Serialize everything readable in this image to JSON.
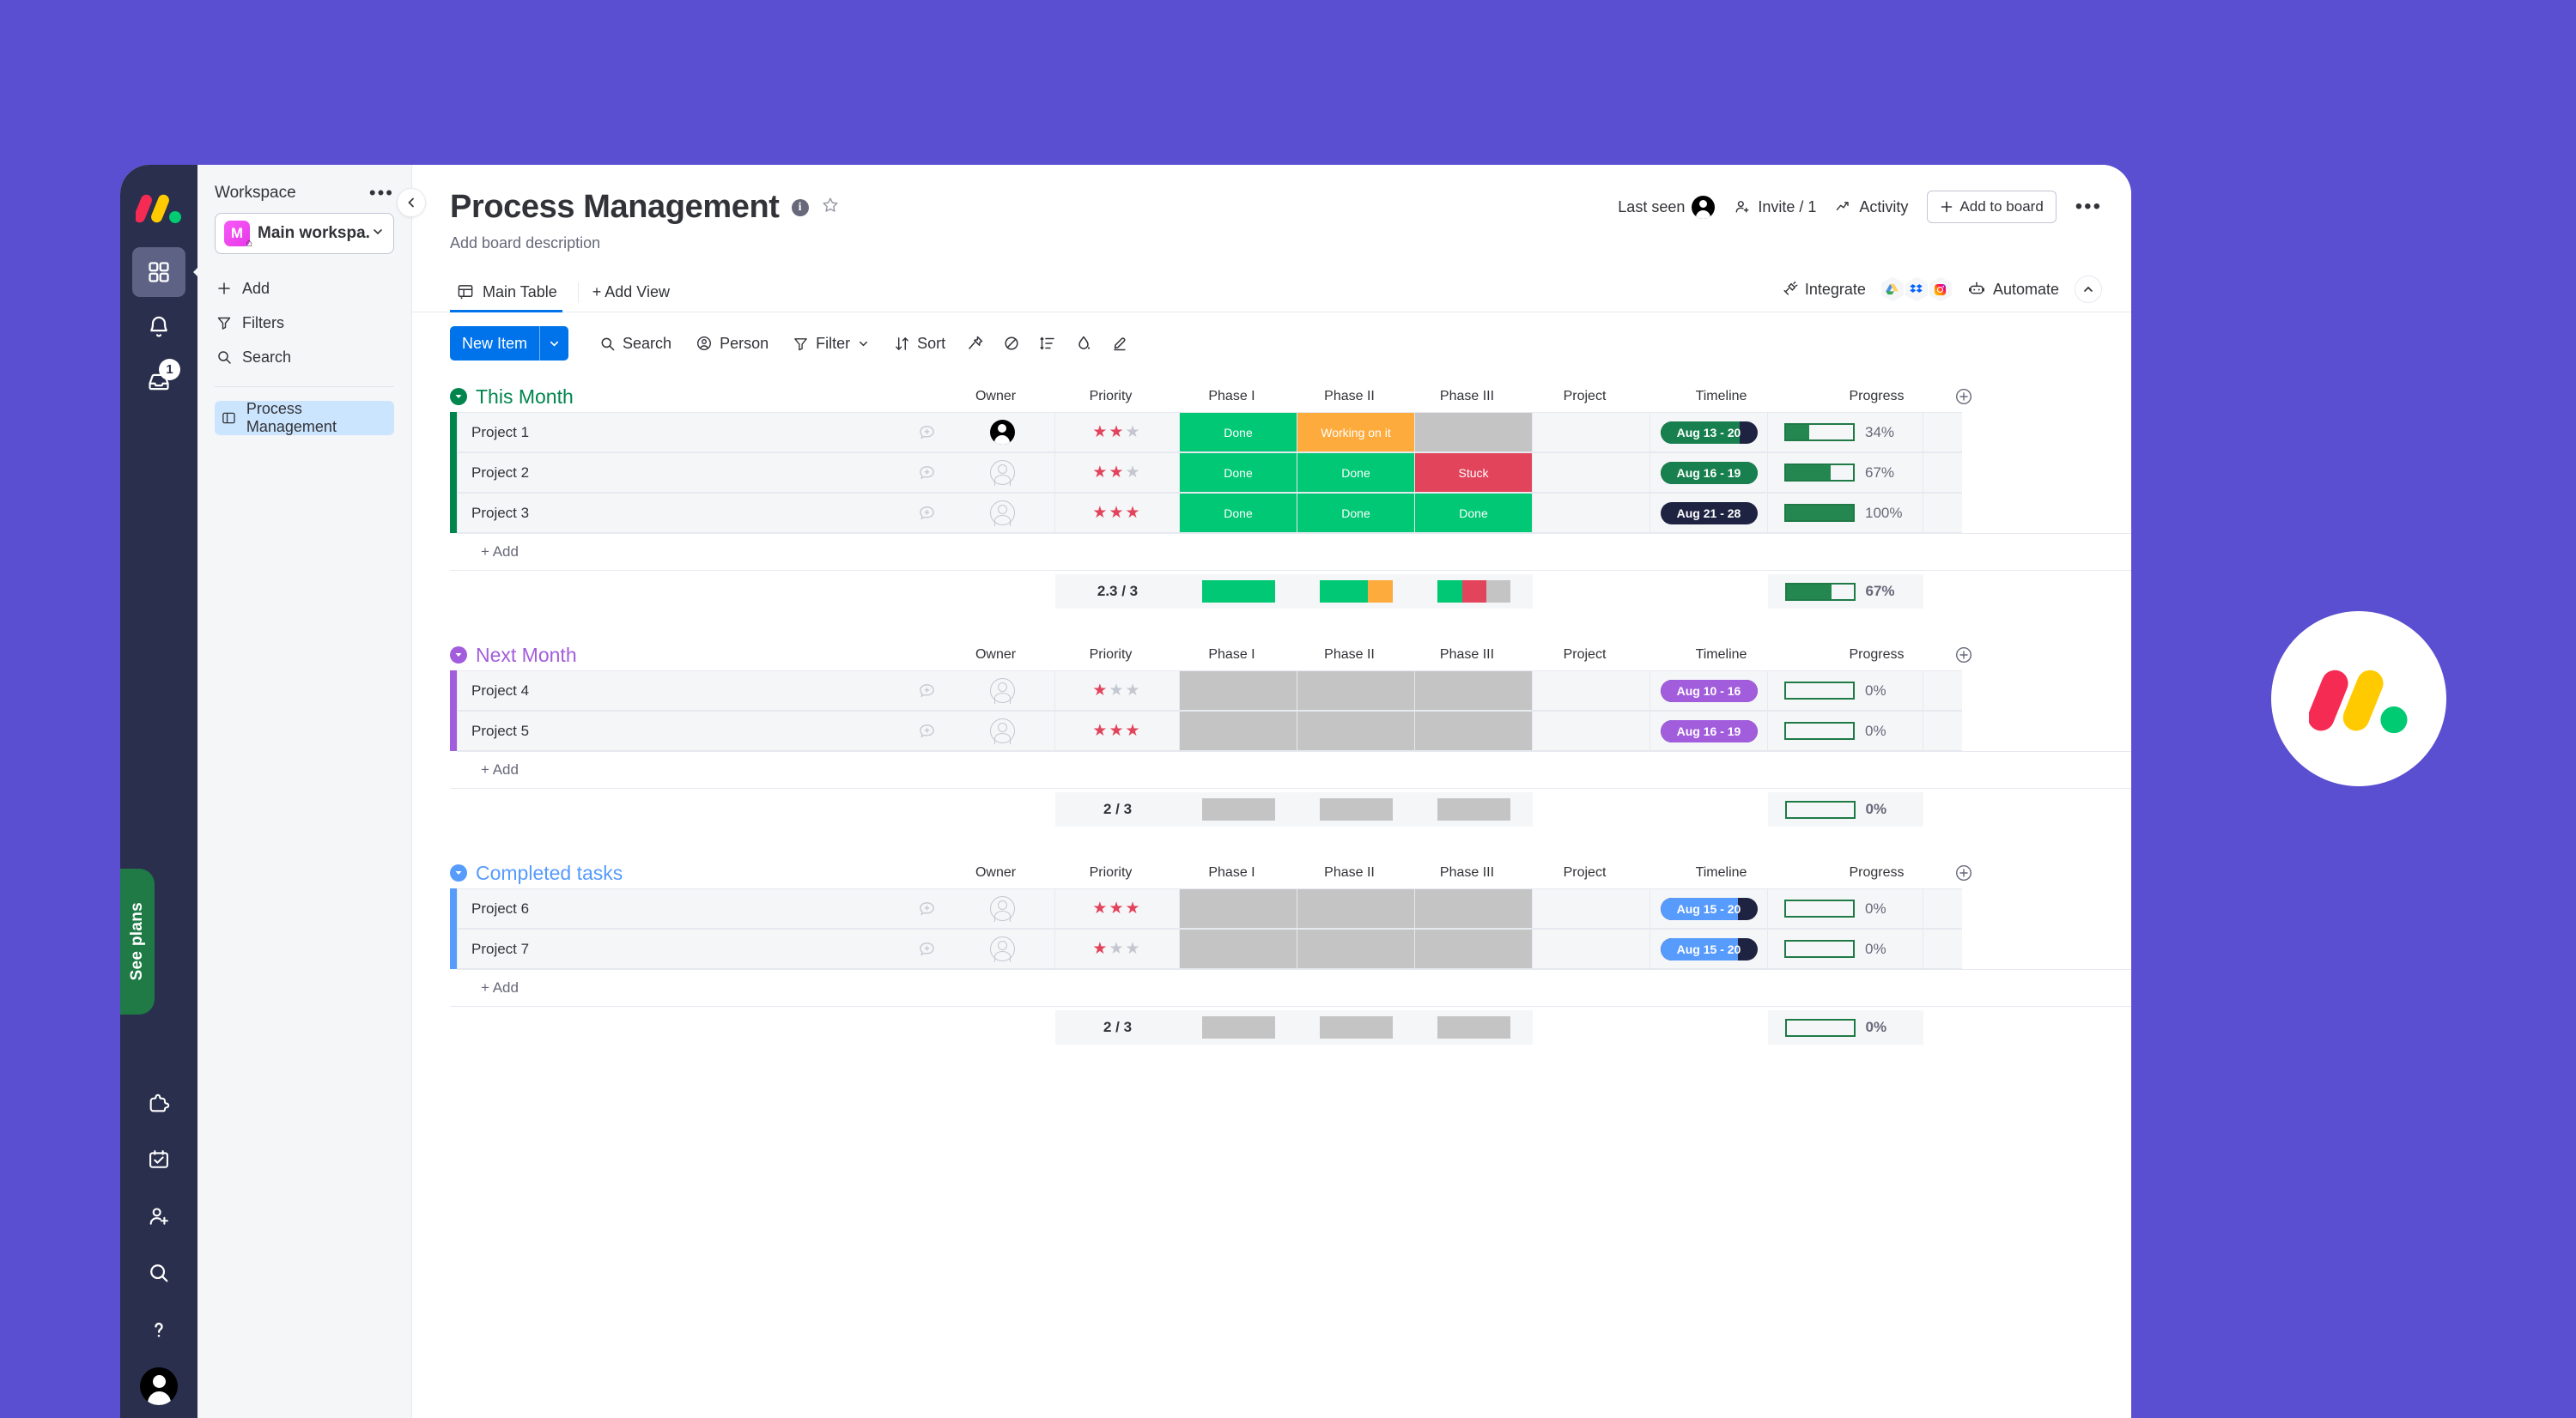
{
  "workspace": {
    "section_label": "Workspace",
    "name": "Main workspa...",
    "avatar_initial": "M",
    "menu": [
      {
        "label": "Add",
        "icon": "plus-icon"
      },
      {
        "label": "Filters",
        "icon": "filter-icon"
      },
      {
        "label": "Search",
        "icon": "search-icon"
      }
    ],
    "board_item": "Process Management",
    "notification_badge": "1",
    "see_plans": "See plans"
  },
  "board": {
    "title": "Process Management",
    "description": "Add board description",
    "tabs": [
      {
        "label": "Main Table",
        "active": true
      },
      {
        "label": "+ Add View",
        "active": false
      }
    ],
    "header_actions": {
      "last_seen": "Last seen",
      "invite": "Invite / 1",
      "activity": "Activity",
      "add_to_board": "Add to board",
      "more": "•••"
    },
    "view_actions": {
      "integrate": "Integrate",
      "automate": "Automate"
    }
  },
  "toolbar": {
    "new_item": "New Item",
    "items": [
      {
        "label": "Search",
        "icon": "search-icon"
      },
      {
        "label": "Person",
        "icon": "person-icon"
      },
      {
        "label": "Filter",
        "icon": "filter-icon",
        "caret": true
      },
      {
        "label": "Sort",
        "icon": "sort-icon"
      }
    ],
    "icon_only": [
      "pin-icon",
      "hide-icon",
      "group-by-icon",
      "color-fill-icon",
      "highlight-icon"
    ]
  },
  "columns": [
    "Owner",
    "Priority",
    "Phase I",
    "Phase II",
    "Phase III",
    "Project",
    "Timeline",
    "Progress"
  ],
  "colors": {
    "accent_blue": "#0073ea",
    "group_green": "#00854d",
    "group_purple": "#a25ddc",
    "group_blue": "#579bfc",
    "status_done": "#00c875",
    "status_working": "#fdab3d",
    "status_stuck": "#e2445c",
    "status_empty": "#c4c4c4",
    "timeline_dark": "#1f2342",
    "progress_green": "#258750",
    "canvas_purple": "#5a4ed1"
  },
  "groups": [
    {
      "name": "This Month",
      "color": "#00854d",
      "add_label": "+ Add",
      "items": [
        {
          "name": "Project 1",
          "owner": "filled",
          "priority": 2,
          "phases": [
            "Done",
            "Working on it",
            ""
          ],
          "project": "",
          "timeline": {
            "label": "Aug 13 - 20",
            "color": "#17804e",
            "fill_pct": 82
          },
          "progress": {
            "pct": "34%",
            "value": 34
          }
        },
        {
          "name": "Project 2",
          "owner": "empty",
          "priority": 2,
          "phases": [
            "Done",
            "Done",
            "Stuck"
          ],
          "project": "",
          "timeline": {
            "label": "Aug 16 - 19",
            "color": "#17804e",
            "fill_pct": 100
          },
          "progress": {
            "pct": "67%",
            "value": 67
          }
        },
        {
          "name": "Project 3",
          "owner": "empty",
          "priority": 3,
          "phases": [
            "Done",
            "Done",
            "Done"
          ],
          "project": "",
          "timeline": {
            "label": "Aug 21 - 28",
            "color": "#1f2342",
            "fill_pct": 0
          },
          "progress": {
            "pct": "100%",
            "value": 100
          }
        }
      ],
      "summary": {
        "priority": "2.3 / 3",
        "phase_batteries": [
          [
            {
              "color": "#00c875",
              "pct": 100
            }
          ],
          [
            {
              "color": "#00c875",
              "pct": 66
            },
            {
              "color": "#fdab3d",
              "pct": 34
            }
          ],
          [
            {
              "color": "#00c875",
              "pct": 34
            },
            {
              "color": "#e2445c",
              "pct": 33
            },
            {
              "color": "#c4c4c4",
              "pct": 33
            }
          ]
        ],
        "progress": {
          "pct": "67%",
          "value": 67
        }
      }
    },
    {
      "name": "Next Month",
      "color": "#a25ddc",
      "add_label": "+ Add",
      "items": [
        {
          "name": "Project 4",
          "owner": "empty",
          "priority": 1,
          "phases": [
            "",
            "",
            ""
          ],
          "project": "",
          "timeline": {
            "label": "Aug 10 - 16",
            "color": "#a25ddc",
            "fill_pct": 100
          },
          "progress": {
            "pct": "0%",
            "value": 0
          }
        },
        {
          "name": "Project 5",
          "owner": "empty",
          "priority": 3,
          "phases": [
            "",
            "",
            ""
          ],
          "project": "",
          "timeline": {
            "label": "Aug 16 - 19",
            "color": "#a25ddc",
            "fill_pct": 100
          },
          "progress": {
            "pct": "0%",
            "value": 0
          }
        }
      ],
      "summary": {
        "priority": "2 / 3",
        "phase_batteries": [
          [
            {
              "color": "#c4c4c4",
              "pct": 100
            }
          ],
          [
            {
              "color": "#c4c4c4",
              "pct": 100
            }
          ],
          [
            {
              "color": "#c4c4c4",
              "pct": 100
            }
          ]
        ],
        "progress": {
          "pct": "0%",
          "value": 0
        }
      }
    },
    {
      "name": "Completed tasks",
      "color": "#579bfc",
      "add_label": "+ Add",
      "items": [
        {
          "name": "Project 6",
          "owner": "empty",
          "priority": 3,
          "phases": [
            "",
            "",
            ""
          ],
          "project": "",
          "timeline": {
            "label": "Aug 15 - 20",
            "color": "#579bfc",
            "fill_pct": 80
          },
          "progress": {
            "pct": "0%",
            "value": 0
          }
        },
        {
          "name": "Project 7",
          "owner": "empty",
          "priority": 1,
          "phases": [
            "",
            "",
            ""
          ],
          "project": "",
          "timeline": {
            "label": "Aug 15 - 20",
            "color": "#579bfc",
            "fill_pct": 80
          },
          "progress": {
            "pct": "0%",
            "value": 0
          }
        }
      ],
      "summary": {
        "priority": "2 / 3",
        "phase_batteries": [
          [
            {
              "color": "#c4c4c4",
              "pct": 100
            }
          ],
          [
            {
              "color": "#c4c4c4",
              "pct": 100
            }
          ],
          [
            {
              "color": "#c4c4c4",
              "pct": 100
            }
          ]
        ],
        "progress": {
          "pct": "0%",
          "value": 0
        }
      }
    }
  ]
}
